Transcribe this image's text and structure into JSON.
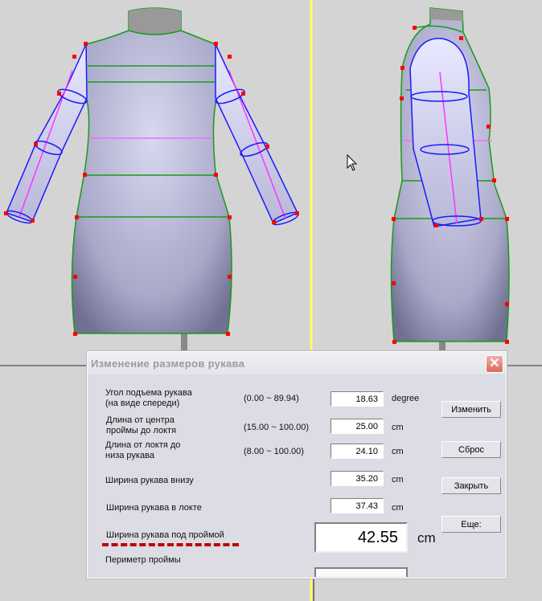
{
  "dialog": {
    "title": "Изменение размеров рукава",
    "rows": [
      {
        "label1": "Угол подъема рукава",
        "label2": "(на виде спереди)",
        "range": "(0.00 ~ 89.94)",
        "value": "18.63",
        "unit": "degree"
      },
      {
        "label1": "Длина от центра",
        "label2": "проймы до локтя",
        "range": "(15.00 ~ 100.00)",
        "value": "25.00",
        "unit": "cm"
      },
      {
        "label1": "Длина от локтя до",
        "label2": "низа рукава",
        "range": "(8.00 ~ 100.00)",
        "value": "24.10",
        "unit": "cm"
      },
      {
        "label1": "Ширина рукава внизу",
        "label2": "",
        "range": "",
        "value": "35.20",
        "unit": "cm"
      },
      {
        "label1": "Ширина рукава  в  локте",
        "label2": "",
        "range": "",
        "value": "37.43",
        "unit": "cm"
      }
    ],
    "highlight": {
      "label": "Ширина рукава под проймой",
      "value": "42.55",
      "unit": "cm"
    },
    "perimeter_label": "Периметр проймы",
    "buttons": {
      "change": "Изменить",
      "reset": "Сброс",
      "close": "Закрыть",
      "more": "Еще:"
    }
  },
  "colors": {
    "seam": "#1a9a1a",
    "sleeve": "#1a1aff",
    "axis": "#ff33ff",
    "points": "#ff0000",
    "underline": "#c00000",
    "divider": "#ffff66"
  }
}
